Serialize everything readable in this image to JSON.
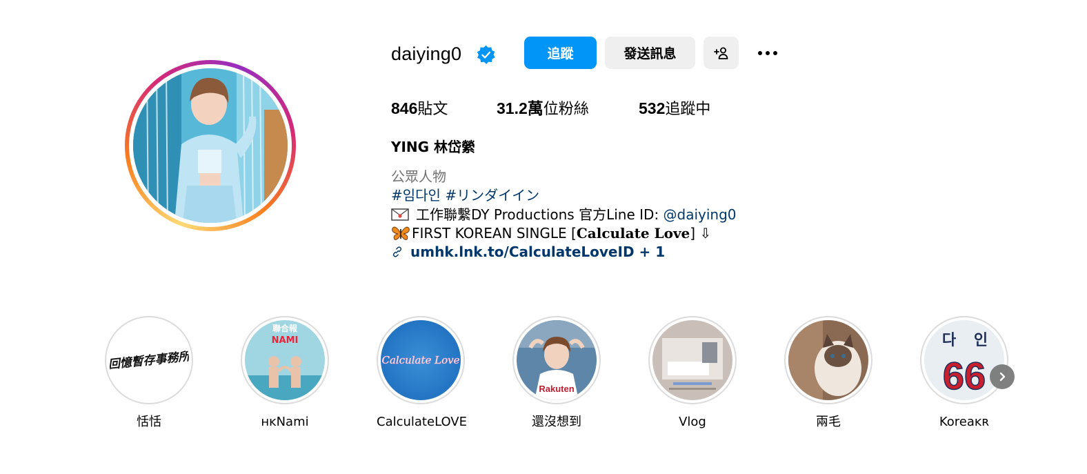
{
  "profile": {
    "username": "daiying0",
    "verified": true,
    "follow_label": "追蹤",
    "message_label": "發送訊息",
    "add_user_icon": "person-add-icon",
    "more_icon": "more-horizontal-icon"
  },
  "stats": {
    "posts_count": "846",
    "posts_label": "貼文",
    "followers_count": "31.2萬",
    "followers_label": "位粉絲",
    "following_count": "532",
    "following_label": "追蹤中"
  },
  "bio": {
    "full_name": "YING 林岱縈",
    "category": "公眾人物",
    "hashtag_1": "#임다인",
    "hashtag_2": "#リンダイイン",
    "contact_icon": "envelope-icon",
    "contact_text": "工作聯繫DY Productions 官方Line ID: ",
    "contact_mention": "@daiying0",
    "single_icon": "butterfly-icon",
    "single_prefix": "FIRST KOREAN SINGLE [",
    "single_title": "Calculate Love",
    "single_suffix": "] ⇩",
    "link_text": "umhk.lnk.to/CalculateLoveID + 1"
  },
  "highlights": [
    {
      "label": "恬恬"
    },
    {
      "label": "ʜᴋNami"
    },
    {
      "label": "CalculateLOVE"
    },
    {
      "label": "還沒想到"
    },
    {
      "label": "Vlog"
    },
    {
      "label": "兩毛"
    },
    {
      "label": "Koreaᴋʀ"
    }
  ],
  "highlight_text": {
    "tiantian_cover": "回憶暫存事務所",
    "nami_brand": "聯合報",
    "nami_title": "NAMI",
    "calc_cover": "Calculate Love",
    "korea_cover_1": "다",
    "korea_cover_2": "인",
    "korea_number": "66",
    "rakuten": "Rakuten"
  },
  "colors": {
    "primary_blue": "#0095f6",
    "link_blue": "#00376b",
    "secondary_gray": "#737373",
    "button_gray": "#efefef",
    "border_gray": "#dbdbdb"
  }
}
